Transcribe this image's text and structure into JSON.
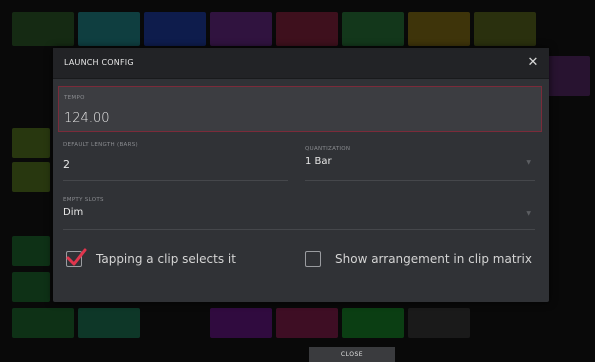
{
  "dialog": {
    "title": "LAUNCH CONFIG",
    "close_icon": "close-icon",
    "tempo": {
      "label": "TEMPO",
      "value": "124.00"
    },
    "default_length": {
      "label": "DEFAULT LENGTH (BARS)",
      "value": "2"
    },
    "quantization": {
      "label": "QUANTIZATION",
      "value": "1 Bar"
    },
    "empty_slots": {
      "label": "EMPTY SLOTS",
      "value": "Dim"
    },
    "options": [
      {
        "label": "Tapping a clip selects it",
        "checked": true
      },
      {
        "label": "Show arrangement in clip matrix",
        "checked": false
      }
    ]
  },
  "footer": {
    "close_label": "CLOSE"
  },
  "colors": {
    "accent_red": "#e0354d",
    "tempo_border": "#7b2b3a",
    "dialog_bg": "#303236",
    "header_bg": "#222326"
  }
}
